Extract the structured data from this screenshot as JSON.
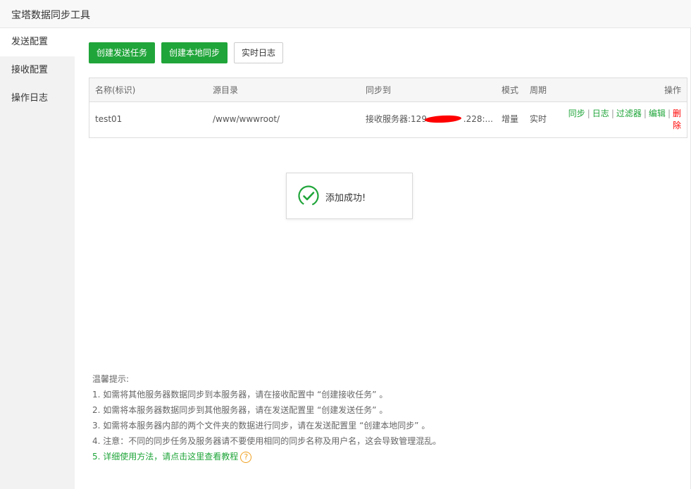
{
  "window": {
    "title": "宝塔数据同步工具"
  },
  "sidebar": {
    "items": [
      {
        "label": "发送配置",
        "active": true
      },
      {
        "label": "接收配置",
        "active": false
      },
      {
        "label": "操作日志",
        "active": false
      }
    ]
  },
  "toolbar": {
    "create_send_task": "创建发送任务",
    "create_local_sync": "创建本地同步",
    "realtime_log": "实时日志"
  },
  "table": {
    "headers": {
      "name": "名称(标识)",
      "source": "源目录",
      "sync_to": "同步到",
      "mode": "模式",
      "cycle": "周期",
      "actions": "操作"
    },
    "rows": [
      {
        "name": "test01",
        "source": "/www/wwwroot/",
        "sync_to": "接收服务器:129.　　　　.228:...",
        "mode": "增量",
        "cycle": "实时",
        "actions": {
          "sync": "同步",
          "log": "日志",
          "filter": "过滤器",
          "edit": "编辑",
          "delete": "删除"
        }
      }
    ]
  },
  "toast": {
    "message": "添加成功!"
  },
  "tips": {
    "title": "温馨提示:",
    "lines": [
      "1. 如需将其他服务器数据同步到本服务器，请在接收配置中 “创建接收任务” 。",
      "2. 如需将本服务器数据同步到其他服务器，请在发送配置里 “创建发送任务” 。",
      "3. 如需将本服务器内部的两个文件夹的数据进行同步，请在发送配置里 “创建本地同步” 。",
      "4. 注意：不同的同步任务及服务器请不要使用相同的同步名称及用户名，这会导致管理混乱。"
    ],
    "tutorial_link": "5. 详细使用方法，请点击这里查看教程",
    "help_glyph": "?"
  },
  "colors": {
    "accent": "#20a53a",
    "danger": "#ff0000",
    "warning": "#f0a020"
  }
}
